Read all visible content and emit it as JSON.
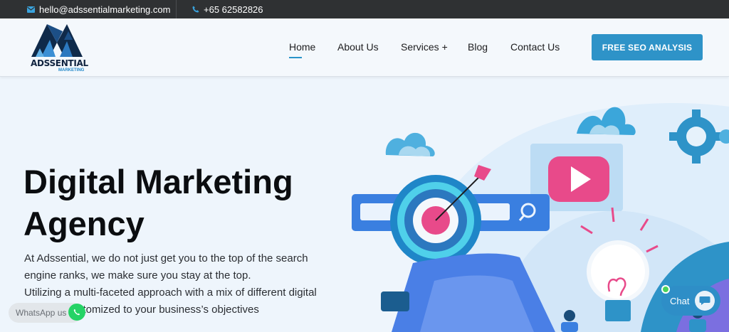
{
  "topbar": {
    "email": "hello@adssentialmarketing.com",
    "phone": "+65 62582826"
  },
  "logo": {
    "name": "ADSSENTIAL",
    "tagline": "MARKETING"
  },
  "nav": {
    "items": [
      {
        "label": "Home",
        "active": true
      },
      {
        "label": "About Us"
      },
      {
        "label": "Services +"
      },
      {
        "label": "Blog"
      },
      {
        "label": "Contact Us"
      }
    ],
    "cta": "FREE SEO ANALYSIS"
  },
  "hero": {
    "title_line1": "Digital Marketing",
    "title_line2": "Agency",
    "text_line1": "At Adssential, we do not just get you to the top of the search",
    "text_line2": "engine ranks, we make sure you stay at the top.",
    "text_line3": "Utilizing a multi-faceted approach with a mix of different digital",
    "text_line4": "stomized to your business’s objectives"
  },
  "widgets": {
    "whatsapp_label": "WhatsApp us",
    "chat_label": "Chat"
  },
  "colors": {
    "accent": "#2e93c8",
    "topbar": "#2f3133",
    "background": "#eef5fc",
    "pink": "#e84a8a",
    "whatsapp": "#25d366"
  },
  "icons": [
    "envelope-icon",
    "phone-icon",
    "search-icon",
    "play-icon",
    "target-icon",
    "gear-icon",
    "lightbulb-icon",
    "whatsapp-icon",
    "chat-icon"
  ]
}
